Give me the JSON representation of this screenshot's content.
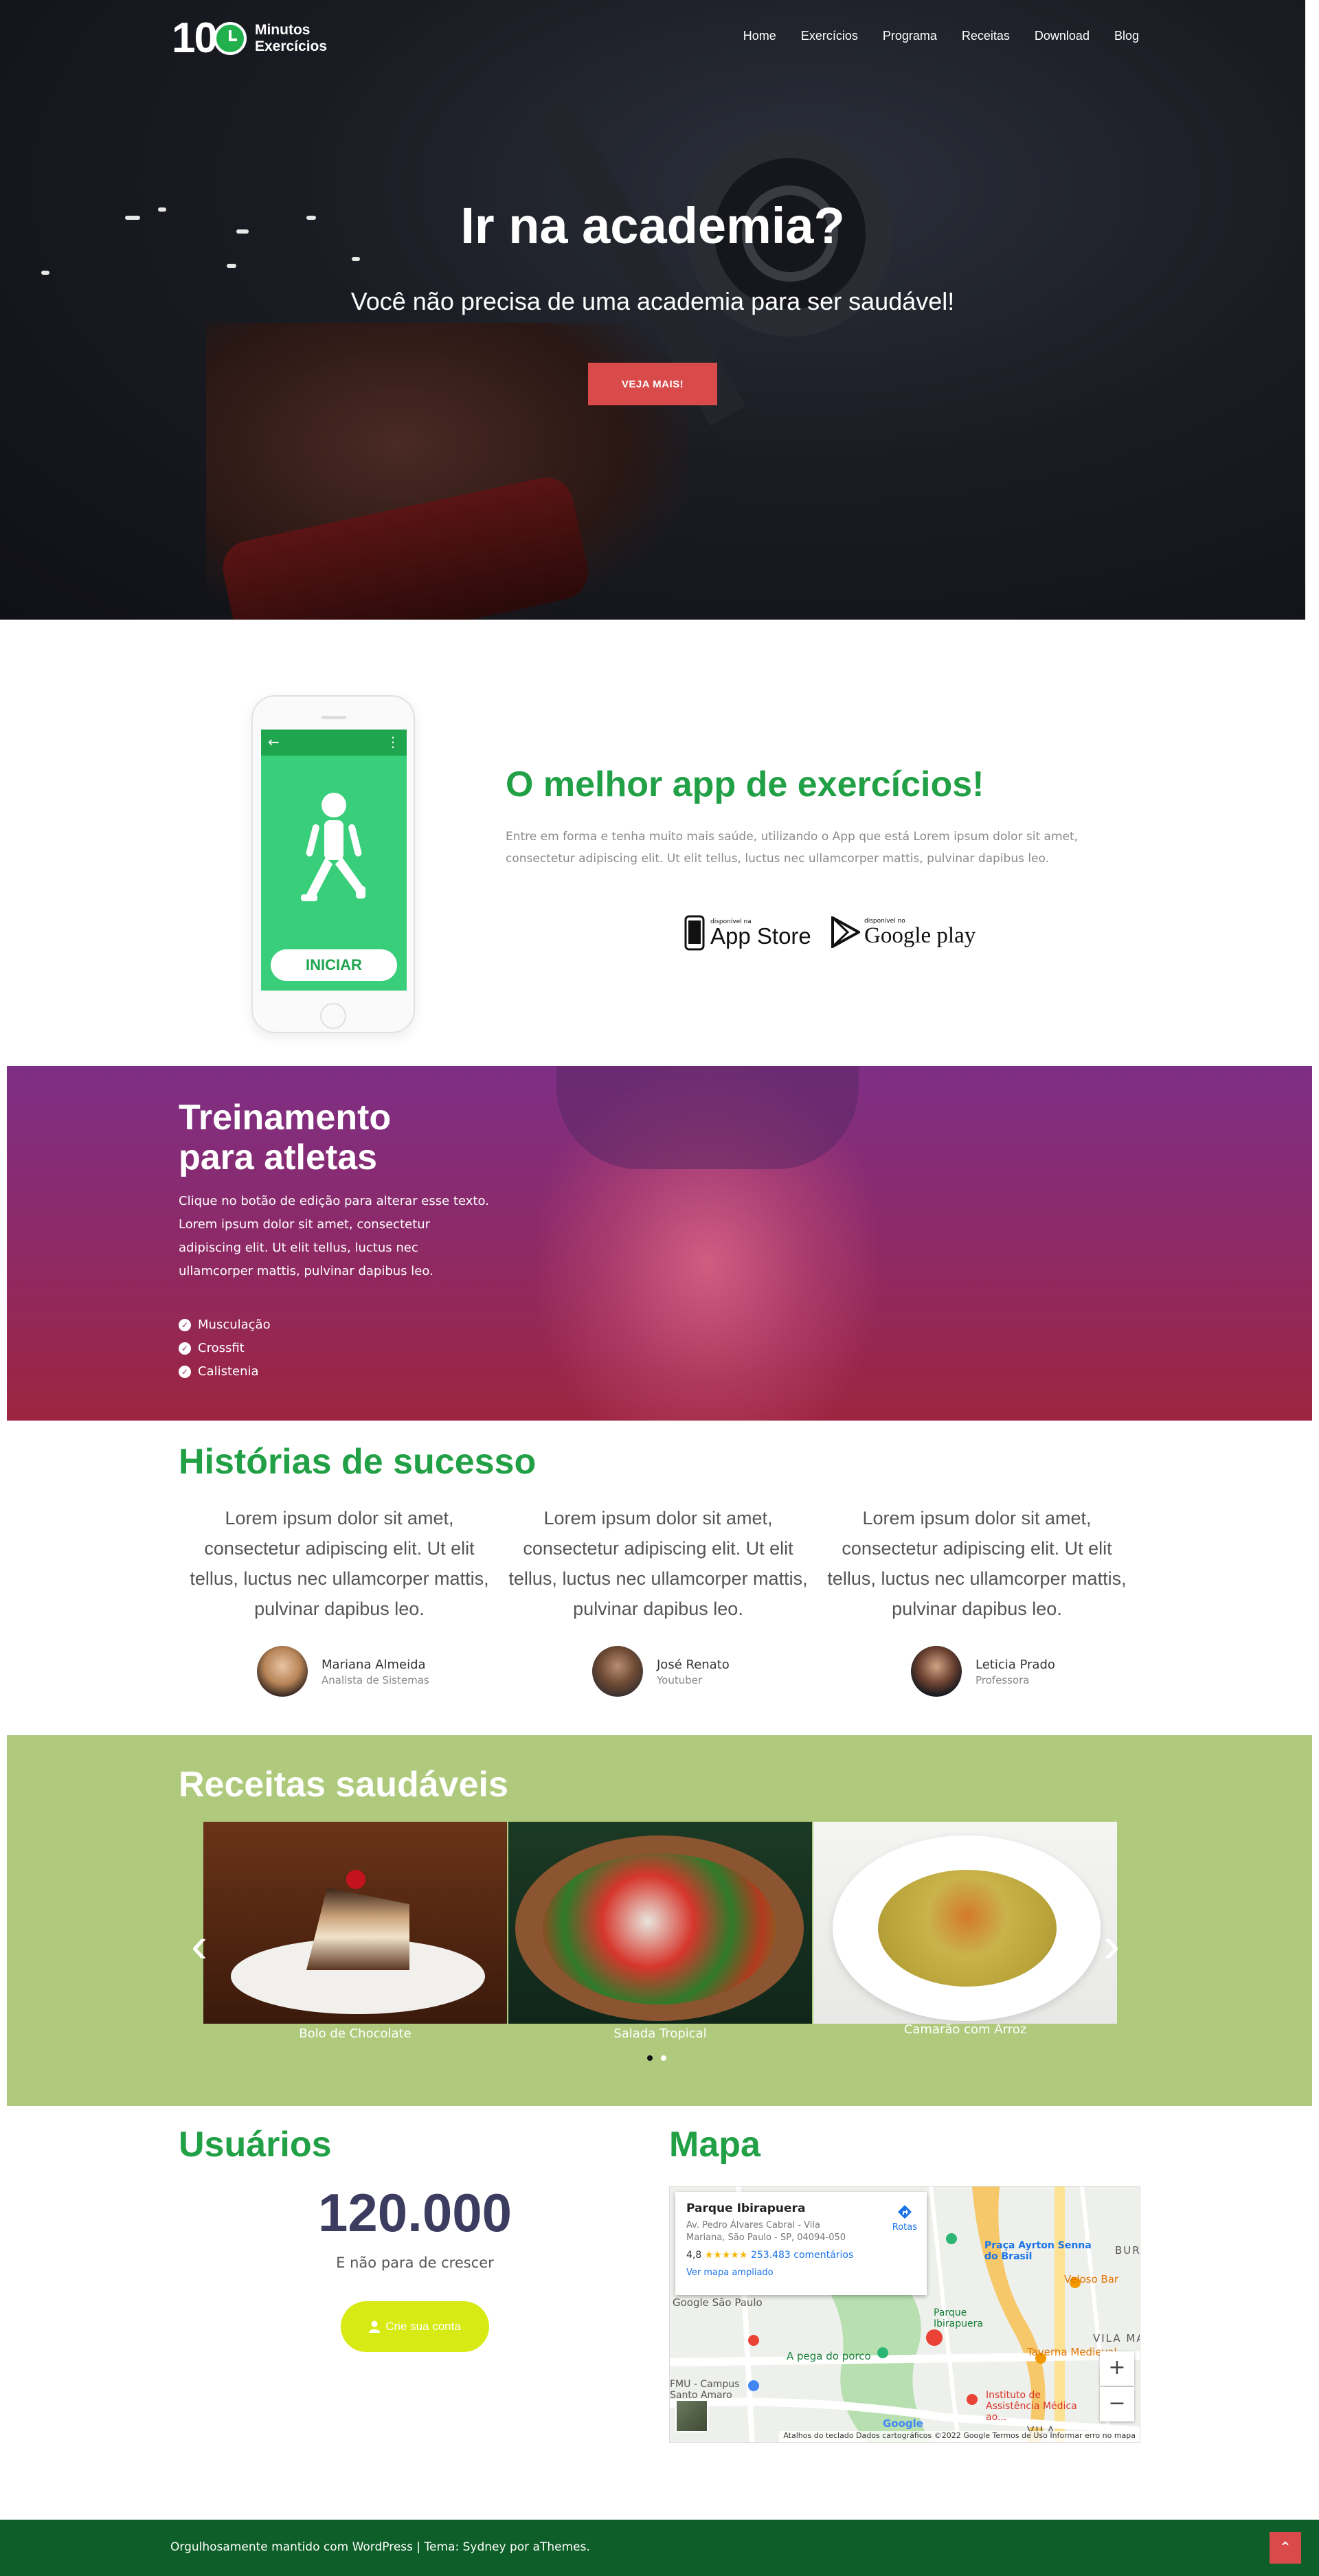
{
  "header": {
    "logo_number": "10",
    "logo_line1": "Minutos",
    "logo_line2": "Exercícios",
    "nav": [
      "Home",
      "Exercícios",
      "Programa",
      "Receitas",
      "Download",
      "Blog"
    ]
  },
  "hero": {
    "title": "Ir na academia?",
    "subtitle": "Você não precisa de uma academia para ser saudável!",
    "button": "VEJA MAIS!"
  },
  "app": {
    "phone_button": "INICIAR",
    "title": "O melhor app de exercícios!",
    "description": "Entre em forma e tenha muito mais saúde, utilizando o App que está Lorem ipsum dolor sit amet, consectetur adipiscing elit. Ut elit tellus, luctus nec ullamcorper mattis, pulvinar dapibus leo.",
    "appstore_small": "disponível na",
    "appstore_big": "App Store",
    "googleplay_small": "disponível no",
    "googleplay_big": "Google play"
  },
  "training": {
    "title_line1": "Treinamento",
    "title_line2": "para atletas",
    "description": "Clique no botão de edição para alterar esse texto. Lorem ipsum dolor sit amet, consectetur adipiscing elit. Ut elit tellus, luctus nec ullamcorper mattis, pulvinar dapibus leo.",
    "items": [
      "Musculação",
      "Crossfit",
      "Calistenia"
    ]
  },
  "stories": {
    "title": "Histórias de sucesso",
    "items": [
      {
        "text": "Lorem ipsum dolor sit amet, consectetur adipiscing elit. Ut elit tellus, luctus nec ullamcorper mattis, pulvinar dapibus leo.",
        "name": "Mariana Almeida",
        "role": "Analista de Sistemas"
      },
      {
        "text": "Lorem ipsum dolor sit amet, consectetur adipiscing elit. Ut elit tellus, luctus nec ullamcorper mattis, pulvinar dapibus leo.",
        "name": "José Renato",
        "role": "Youtuber"
      },
      {
        "text": "Lorem ipsum dolor sit amet, consectetur adipiscing elit. Ut elit tellus, luctus nec ullamcorper mattis, pulvinar dapibus leo.",
        "name": "Leticia Prado",
        "role": "Professora"
      }
    ]
  },
  "recipes": {
    "title": "Receitas saudáveis",
    "items": [
      "Bolo de Chocolate",
      "Salada Tropical",
      "Camarão com Arroz"
    ],
    "prev_icon": "chevron-left-icon",
    "next_icon": "chevron-right-icon"
  },
  "users": {
    "title": "Usuários",
    "count": "120.000",
    "subtitle": "E não para de crescer",
    "button": "Crie sua conta"
  },
  "map": {
    "title": "Mapa",
    "place": "Parque Ibirapuera",
    "address": "Av. Pedro Álvares Cabral - Vila Mariana, São Paulo - SP, 04094-050",
    "rating": "4,8",
    "stars": "★★★★★",
    "reviews": "253.483 comentários",
    "larger_map": "Ver mapa ampliado",
    "routes": "Rotas",
    "labels": [
      "Praça Ayrton Senna do Brasil",
      "Veloso Bar",
      "Google São Paulo",
      "Parque Ibirapuera",
      "Taverna Medieval",
      "A pega do porco",
      "FMU - Campus Santo Amaro",
      "Instituto de Assistência Médica ao...",
      "VILA MA",
      "BURA",
      "VILA",
      "Google"
    ],
    "footer": "Atalhos do teclado   Dados cartográficos ©2022 Google   Termos de Uso   Informar erro no mapa",
    "zoom_in": "+",
    "zoom_out": "−"
  },
  "footer": {
    "text": "Orgulhosamente mantido com WordPress | Tema: Sydney por aThemes.",
    "scroll_top": "⌃"
  },
  "colors": {
    "green": "#21a046",
    "dark_green": "#0d5e28",
    "red": "#d94a4a",
    "recipe_bg": "#afca7d",
    "lime": "#d7ea14",
    "navy": "#3c3b60"
  }
}
